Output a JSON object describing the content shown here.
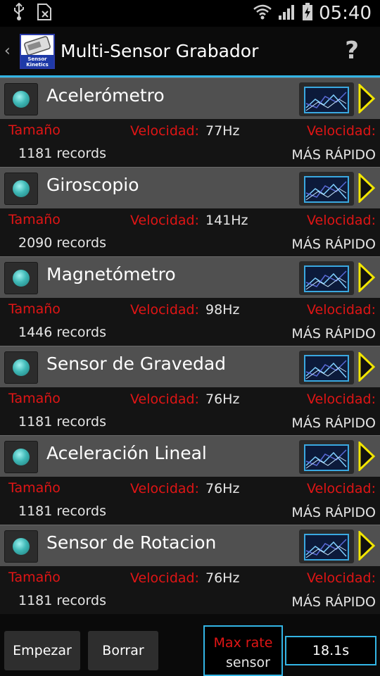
{
  "status_bar": {
    "time": "05:40"
  },
  "action_bar": {
    "title": "Multi-Sensor Grabador",
    "logo_text": "Sensor Kinetics",
    "help": "?",
    "accent": "#33b5e5"
  },
  "labels": {
    "size": "Tamaño",
    "speed": "Velocidad:",
    "speed_right": "Velocidad:",
    "speed_value": "MÁS RÁPIDO"
  },
  "sensors": [
    {
      "name": "Acelerómetro",
      "hz": "77Hz",
      "records": "1181 records"
    },
    {
      "name": "Giroscopio",
      "hz": "141Hz",
      "records": "2090 records"
    },
    {
      "name": "Magnetómetro",
      "hz": "98Hz",
      "records": "1446 records"
    },
    {
      "name": "Sensor de Gravedad",
      "hz": "76Hz",
      "records": "1181 records"
    },
    {
      "name": "Aceleración Lineal",
      "hz": "76Hz",
      "records": "1181 records"
    },
    {
      "name": "Sensor de Rotacion",
      "hz": "76Hz",
      "records": "1181 records"
    }
  ],
  "bottom": {
    "start_label": "Empezar",
    "clear_label": "Borrar",
    "rate_line1": "Max rate",
    "rate_line2": "sensor",
    "elapsed": "18.1s"
  },
  "colors": {
    "red_label": "#e01515",
    "accent": "#33b5e5",
    "play_yellow": "#f2e600"
  }
}
